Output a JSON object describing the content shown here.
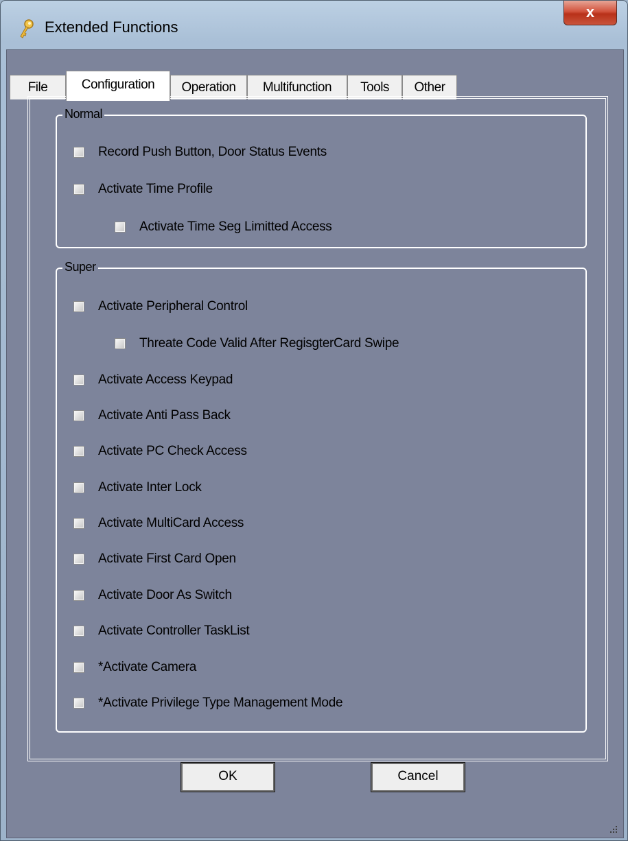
{
  "window": {
    "title": "Extended Functions",
    "icon": "key-icon",
    "close_label": "x"
  },
  "tabs": [
    {
      "label": "File",
      "active": false
    },
    {
      "label": "Configuration",
      "active": true
    },
    {
      "label": "Operation",
      "active": false
    },
    {
      "label": "Multifunction",
      "active": false
    },
    {
      "label": "Tools",
      "active": false
    },
    {
      "label": "Other",
      "active": false
    }
  ],
  "groups": {
    "normal": {
      "title": "Normal",
      "items": [
        {
          "label": "Record Push Button, Door Status Events",
          "checked": false
        },
        {
          "label": "Activate Time Profile",
          "checked": false
        },
        {
          "label": "Activate Time Seg Limitted Access",
          "checked": false
        }
      ]
    },
    "super": {
      "title": "Super",
      "items": [
        {
          "label": "Activate Peripheral Control",
          "checked": false
        },
        {
          "label": "Threate Code Valid After RegisgterCard Swipe",
          "checked": false
        },
        {
          "label": "Activate Access Keypad",
          "checked": false
        },
        {
          "label": "Activate Anti Pass Back",
          "checked": false
        },
        {
          "label": "Activate PC Check Access",
          "checked": false
        },
        {
          "label": "Activate Inter Lock",
          "checked": false
        },
        {
          "label": "Activate MultiCard Access",
          "checked": false
        },
        {
          "label": "Activate First Card Open",
          "checked": false
        },
        {
          "label": "Activate Door As Switch",
          "checked": false
        },
        {
          "label": "Activate Controller TaskList",
          "checked": false
        },
        {
          "label": "*Activate Camera",
          "checked": false
        },
        {
          "label": "*Activate Privilege Type Management Mode",
          "checked": false
        }
      ]
    }
  },
  "buttons": {
    "ok": "OK",
    "cancel": "Cancel"
  },
  "colors": {
    "client_background": "#7d849b",
    "tab_background": "#f0f0f0",
    "group_border": "#ffffff",
    "close_button": "#c9543b"
  }
}
